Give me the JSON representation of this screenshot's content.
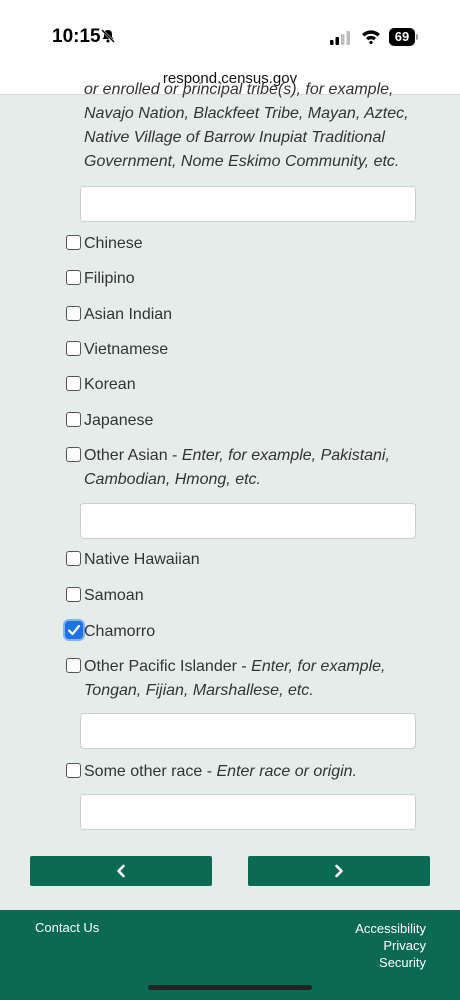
{
  "status": {
    "time": "10:15",
    "battery": "69"
  },
  "browser": {
    "url": "respond.census.gov"
  },
  "main": {
    "partial_description": "or enrolled or principal tribe(s), for example, Navajo Nation, Blackfeet Tribe, Mayan, Aztec, Native Village of Barrow Inupiat Traditional Government, Nome Eskimo Community, etc.",
    "options": [
      {
        "label": "Chinese",
        "hint": "",
        "checked": false
      },
      {
        "label": "Filipino",
        "hint": "",
        "checked": false
      },
      {
        "label": "Asian Indian",
        "hint": "",
        "checked": false
      },
      {
        "label": "Vietnamese",
        "hint": "",
        "checked": false
      },
      {
        "label": "Korean",
        "hint": "",
        "checked": false
      },
      {
        "label": "Japanese",
        "hint": "",
        "checked": false
      },
      {
        "label": "Other Asian - ",
        "hint": "Enter, for example, Pakistani, Cambodian, Hmong, etc.",
        "checked": false
      },
      {
        "label": "Native Hawaiian",
        "hint": "",
        "checked": false
      },
      {
        "label": "Samoan",
        "hint": "",
        "checked": false
      },
      {
        "label": "Chamorro",
        "hint": "",
        "checked": true
      },
      {
        "label": "Other Pacific Islander - ",
        "hint": "Enter, for example, Tongan, Fijian, Marshallese, etc.",
        "checked": false
      },
      {
        "label": "Some other race - ",
        "hint": "Enter race or origin.",
        "checked": false
      }
    ],
    "text_inputs": [
      {
        "value": "",
        "placeholder": ""
      },
      {
        "value": "",
        "placeholder": ""
      },
      {
        "value": "",
        "placeholder": ""
      },
      {
        "value": "",
        "placeholder": ""
      }
    ]
  },
  "footer": {
    "contact": "Contact Us",
    "accessibility": "Accessibility",
    "privacy": "Privacy",
    "security": "Security"
  },
  "colors": {
    "brand_green": "#0b6b52",
    "check_blue": "#1e72e8",
    "background": "#e6ecea"
  }
}
